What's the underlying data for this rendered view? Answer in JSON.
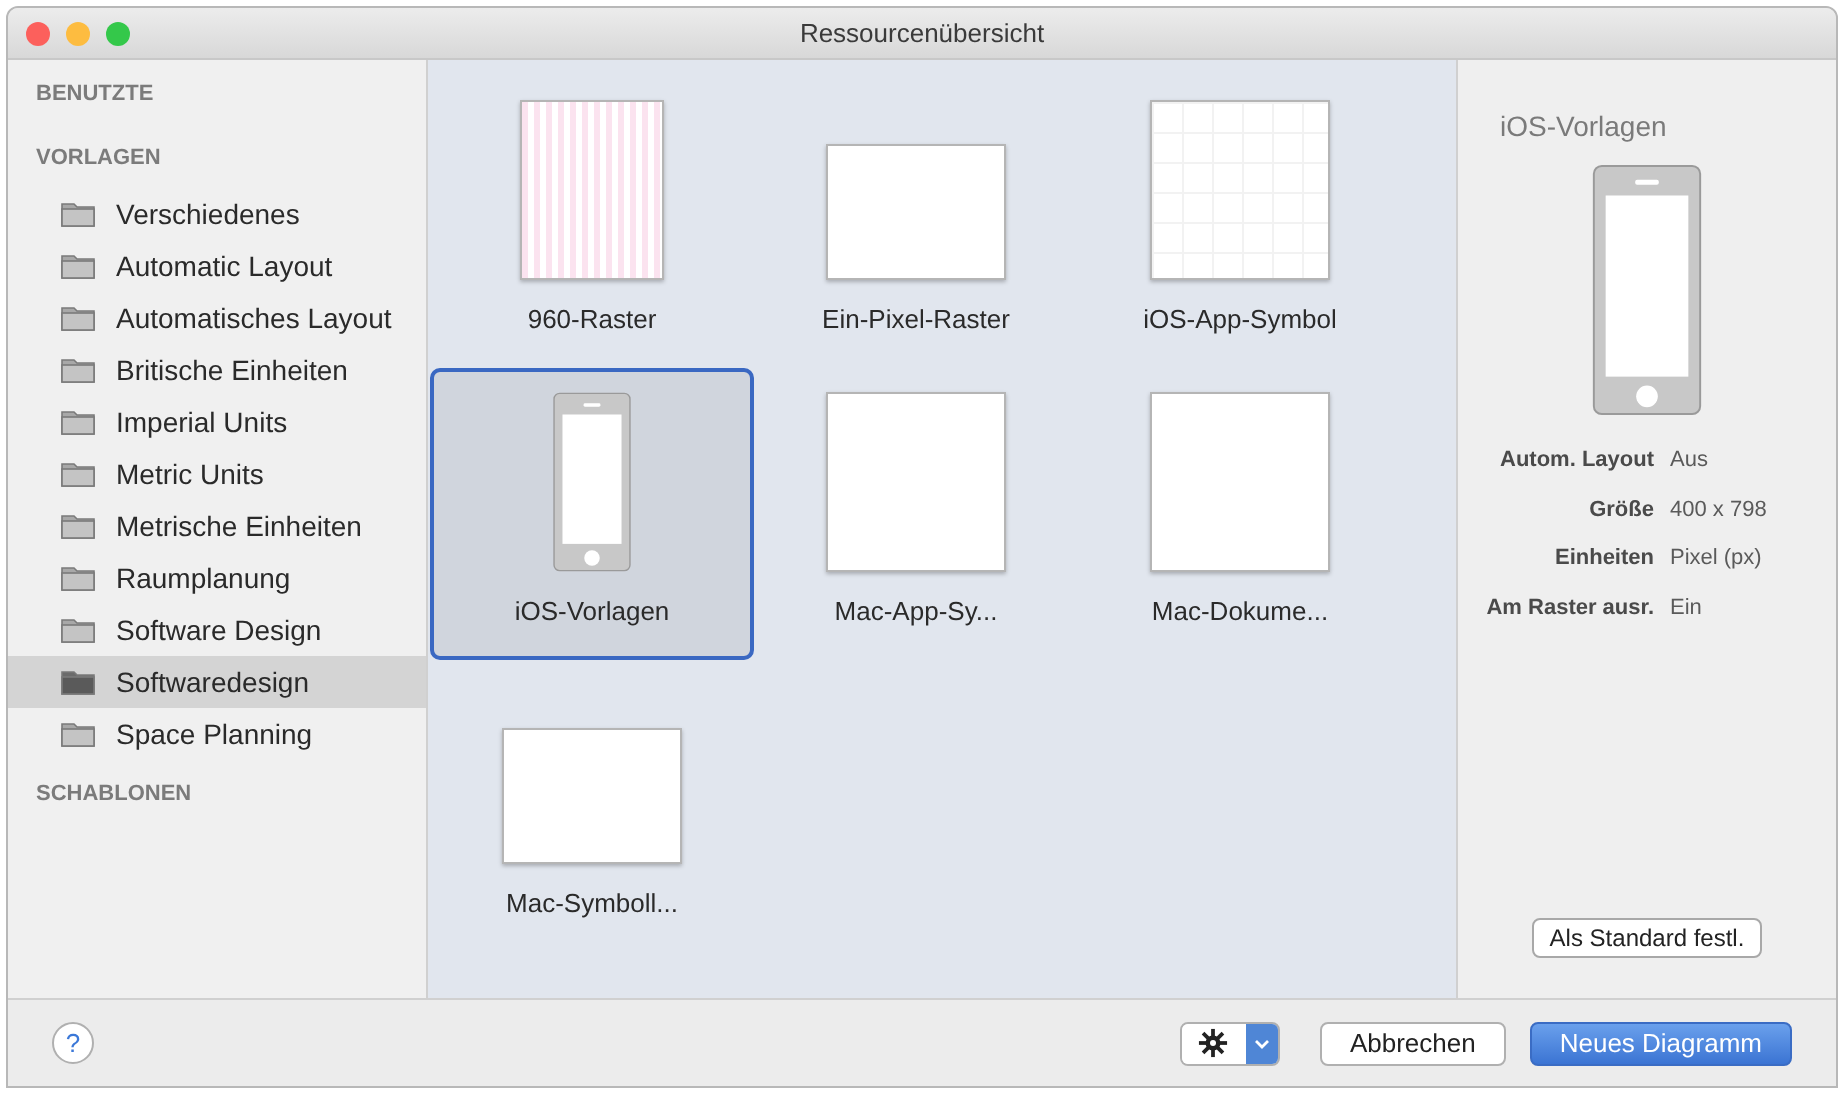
{
  "window": {
    "title": "Ressourcenübersicht"
  },
  "sidebar": {
    "sections": [
      {
        "title": "BENUTZTE"
      },
      {
        "title": "VORLAGEN",
        "items": [
          {
            "label": "Verschiedenes",
            "selected": false
          },
          {
            "label": "Automatic Layout",
            "selected": false
          },
          {
            "label": "Automatisches Layout",
            "selected": false
          },
          {
            "label": "Britische Einheiten",
            "selected": false
          },
          {
            "label": "Imperial Units",
            "selected": false
          },
          {
            "label": "Metric Units",
            "selected": false
          },
          {
            "label": "Metrische Einheiten",
            "selected": false
          },
          {
            "label": "Raumplanung",
            "selected": false
          },
          {
            "label": "Software Design",
            "selected": false
          },
          {
            "label": "Softwaredesign",
            "selected": true
          },
          {
            "label": "Space Planning",
            "selected": false
          }
        ]
      },
      {
        "title": "SCHABLONEN"
      }
    ]
  },
  "templates": [
    {
      "label": "960-Raster",
      "kind": "striped",
      "selected": false
    },
    {
      "label": "Ein-Pixel-Raster",
      "kind": "landscape",
      "selected": false
    },
    {
      "label": "iOS-App-Symbol",
      "kind": "grid",
      "selected": false
    },
    {
      "label": "iOS-Vorlagen",
      "kind": "phone",
      "selected": true
    },
    {
      "label": "Mac-App-Sy...",
      "kind": "square",
      "selected": false
    },
    {
      "label": "Mac-Dokume...",
      "kind": "square",
      "selected": false
    },
    {
      "label": "Mac-Symboll...",
      "kind": "landscape",
      "selected": false
    }
  ],
  "details": {
    "title": "iOS-Vorlagen",
    "properties": [
      {
        "name": "Autom. Layout",
        "value": "Aus"
      },
      {
        "name": "Größe",
        "value": "400 x 798"
      },
      {
        "name": "Einheiten",
        "value": "Pixel (px)"
      },
      {
        "name": "Am Raster ausr.",
        "value": "Ein"
      }
    ],
    "default_button": "Als Standard festl."
  },
  "footer": {
    "help": "?",
    "buttons": [
      {
        "label": "Abbrechen",
        "kind": "secondary"
      },
      {
        "label": "Neues Diagramm",
        "kind": "primary"
      }
    ]
  }
}
